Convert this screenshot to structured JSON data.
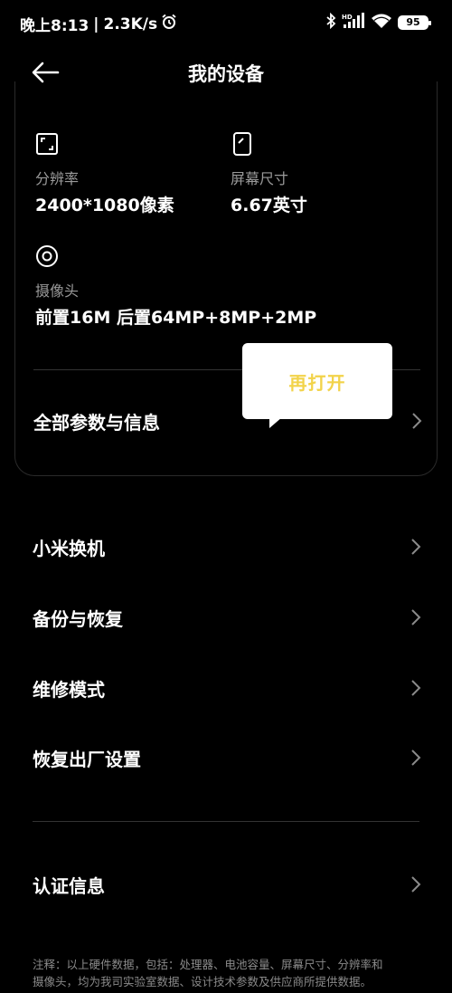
{
  "status_bar": {
    "time": "晚上8:13",
    "separator": "|",
    "speed": "2.3K/s",
    "battery_level": "95",
    "icons": [
      "alarm-icon",
      "bluetooth-icon",
      "hd-signal-icon",
      "wifi-icon",
      "battery-icon"
    ]
  },
  "header": {
    "title": "我的设备"
  },
  "specs": {
    "resolution": {
      "label": "分辨率",
      "value": "2400*1080像素",
      "icon": "resolution-icon"
    },
    "screen_size": {
      "label": "屏幕尺寸",
      "value": "6.67英寸",
      "icon": "screen-size-icon"
    },
    "camera": {
      "label": "摄像头",
      "value": "前置16M 后置64MP+8MP+2MP",
      "icon": "camera-icon"
    }
  },
  "all_params": {
    "label": "全部参数与信息"
  },
  "tooltip": {
    "text": "再打开",
    "color": "#f2d34a"
  },
  "menu": {
    "items": [
      {
        "label": "小米换机"
      },
      {
        "label": "备份与恢复"
      },
      {
        "label": "维修模式"
      },
      {
        "label": "恢复出厂设置"
      }
    ]
  },
  "certification": {
    "label": "认证信息"
  },
  "footnote": {
    "line1": "注释：以上硬件数据，包括：处理器、电池容量、屏幕尺寸、分辨率和",
    "line2": "摄像头，均为我司实验室数据、设计技术参数及供应商所提供数据。"
  },
  "colors": {
    "background": "#000000",
    "text_primary": "#ffffff",
    "text_secondary": "#9a9a9a",
    "divider": "#333333"
  }
}
